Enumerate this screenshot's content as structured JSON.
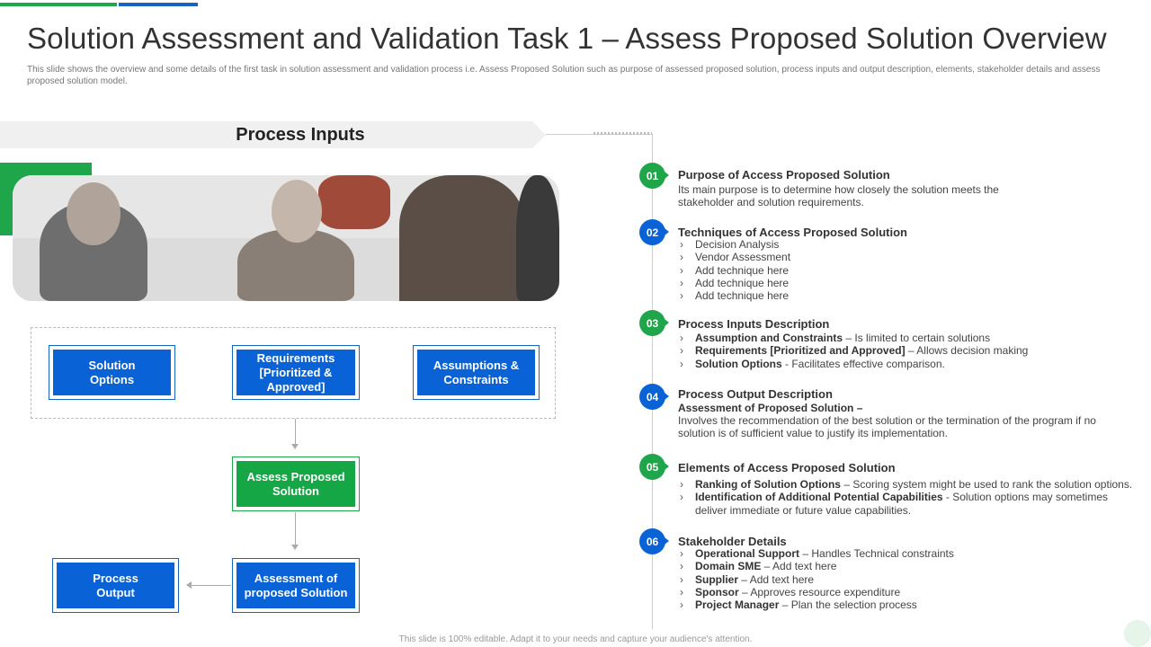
{
  "title": "Solution Assessment and Validation Task 1 – Assess Proposed Solution Overview",
  "subtitle": "This slide shows the overview and some details of the first task in solution assessment and validation process i.e. Assess Proposed Solution such as purpose of assessed proposed solution, process inputs and output description, elements, stakeholder details and assess proposed solution model.",
  "banner": "Process Inputs",
  "photo_icon": "meeting-photo",
  "diagram": {
    "input1": "Solution Options",
    "input2": "Requirements [Prioritized & Approved]",
    "input3": "Assumptions & Constraints",
    "process": "Assess Proposed Solution",
    "assessment": "Assessment of proposed Solution",
    "output": "Process Output"
  },
  "sections": [
    {
      "num": "01",
      "title": "Purpose of Access Proposed Solution",
      "text": "Its main purpose is to determine how closely the solution meets the stakeholder and solution requirements."
    },
    {
      "num": "02",
      "title": "Techniques of Access Proposed Solution",
      "items": [
        "Decision Analysis",
        "Vendor Assessment",
        "Add technique here",
        "Add technique here",
        "Add technique here"
      ]
    },
    {
      "num": "03",
      "title": "Process Inputs Description",
      "items": [
        {
          "bold": "Assumption and Constraints",
          "text": " – Is limited to certain solutions"
        },
        {
          "bold": "Requirements [Prioritized and Approved]",
          "text": " – Allows decision making"
        },
        {
          "bold": "Solution Options",
          "text": " - Facilitates effective comparison."
        }
      ]
    },
    {
      "num": "04",
      "title": "Process Output Description",
      "bold": "Assessment of Proposed Solution",
      "bold_suffix": " –",
      "text": "Involves the recommendation of the best solution or the termination of the program if no solution is of sufficient value to justify its implementation."
    },
    {
      "num": "05",
      "title": "Elements of Access Proposed Solution",
      "items": [
        {
          "bold": "Ranking of Solution Options",
          "text": " – Scoring system might be used to rank the solution options."
        },
        {
          "bold": "Identification of Additional Potential Capabilities",
          "text": " - Solution options may sometimes deliver immediate or future value capabilities."
        }
      ]
    },
    {
      "num": "06",
      "title": "Stakeholder Details",
      "items": [
        {
          "bold": "Operational Support",
          "text": " – Handles Technical constraints"
        },
        {
          "bold": "Domain SME",
          "text": " – Add text here"
        },
        {
          "bold": "Supplier",
          "text": " – Add text here"
        },
        {
          "bold": "Sponsor",
          "text": " – Approves resource expenditure"
        },
        {
          "bold": "Project Manager",
          "text": " – Plan the selection process"
        }
      ]
    }
  ],
  "footer": "This slide is 100% editable. Adapt it to your needs and capture your audience's attention.",
  "colors": {
    "green": "#1fa64a",
    "blue": "#0a63d6"
  }
}
